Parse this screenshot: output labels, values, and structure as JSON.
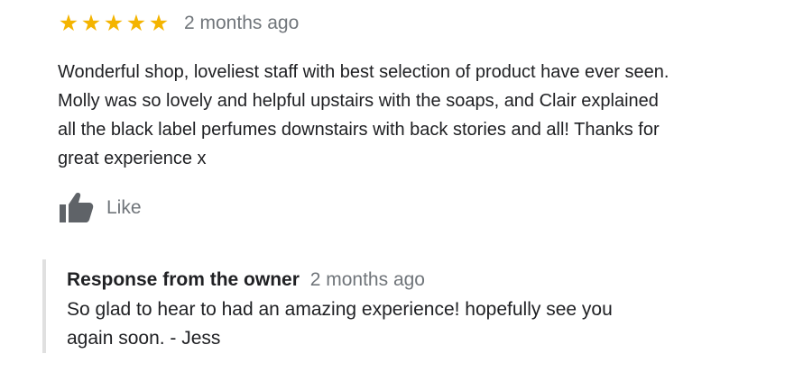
{
  "review": {
    "rating": 5,
    "stars": [
      "★",
      "★",
      "★",
      "★",
      "★"
    ],
    "time": "2 months ago",
    "text": "Wonderful shop, loveliest staff with best selection of product have ever seen.\nMolly was so lovely and helpful upstairs with the soaps, and Clair explained\nall the black label perfumes downstairs with back stories and all! Thanks for\ngreat experience x",
    "like_label": "Like",
    "like_icon": "thumbs-up-icon"
  },
  "owner_response": {
    "title": "Response from the owner",
    "time": "2 months ago",
    "text": "So glad to hear to had an amazing experience! hopefully see you\nagain soon. - Jess"
  },
  "colors": {
    "star": "#f4b400",
    "secondary_text": "#70757a",
    "primary_text": "#202124",
    "icon": "#5f6368",
    "response_border": "#e0e0e0"
  }
}
